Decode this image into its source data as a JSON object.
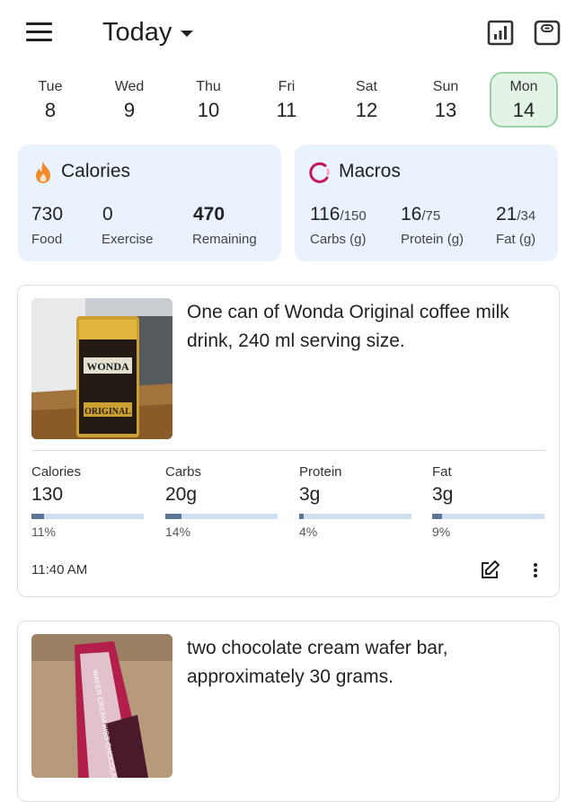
{
  "header": {
    "title": "Today",
    "menu_icon": "hamburger-menu-icon",
    "report_icon": "bar-chart-icon",
    "scale_icon": "weight-scale-icon"
  },
  "days": [
    {
      "name": "Tue",
      "date": "8",
      "selected": false
    },
    {
      "name": "Wed",
      "date": "9",
      "selected": false
    },
    {
      "name": "Thu",
      "date": "10",
      "selected": false
    },
    {
      "name": "Fri",
      "date": "11",
      "selected": false
    },
    {
      "name": "Sat",
      "date": "12",
      "selected": false
    },
    {
      "name": "Sun",
      "date": "13",
      "selected": false
    },
    {
      "name": "Mon",
      "date": "14",
      "selected": true
    }
  ],
  "calories": {
    "title": "Calories",
    "food_value": "730",
    "food_label": "Food",
    "exercise_value": "0",
    "exercise_label": "Exercise",
    "remaining_value": "470",
    "remaining_label": "Remaining"
  },
  "macros": {
    "title": "Macros",
    "carbs_value": "116",
    "carbs_goal": "/150",
    "carbs_label": "Carbs (g)",
    "protein_value": "16",
    "protein_goal": "/75",
    "protein_label": "Protein (g)",
    "fat_value": "21",
    "fat_goal": "/34",
    "fat_label": "Fat (g)"
  },
  "entries": [
    {
      "description": "One can of Wonda Original coffee milk drink, 240 ml serving size.",
      "photo_label": "WONDA",
      "photo_label_2": "ORIGINAL",
      "nutrients": [
        {
          "label": "Calories",
          "value": "130",
          "pct": "11%",
          "fraction": 0.11
        },
        {
          "label": "Carbs",
          "value": "20g",
          "pct": "14%",
          "fraction": 0.14
        },
        {
          "label": "Protein",
          "value": "3g",
          "pct": "4%",
          "fraction": 0.04
        },
        {
          "label": "Fat",
          "value": "3g",
          "pct": "9%",
          "fraction": 0.09
        }
      ],
      "time": "11:40 AM"
    },
    {
      "description": "two chocolate cream wafer bar, approximately 30 grams.",
      "photo_label": "WAFER CREAM KISS CHOCOLATE"
    }
  ],
  "colors": {
    "summary_bg": "#eaf2fd",
    "selected_day_bg": "#e3f4e6",
    "selected_day_border": "#9ad3a6",
    "flame": "#f08a2c",
    "macros_ring": "#c2185b",
    "progress_fill": "#5c7596",
    "progress_track": "#cfdff2"
  }
}
